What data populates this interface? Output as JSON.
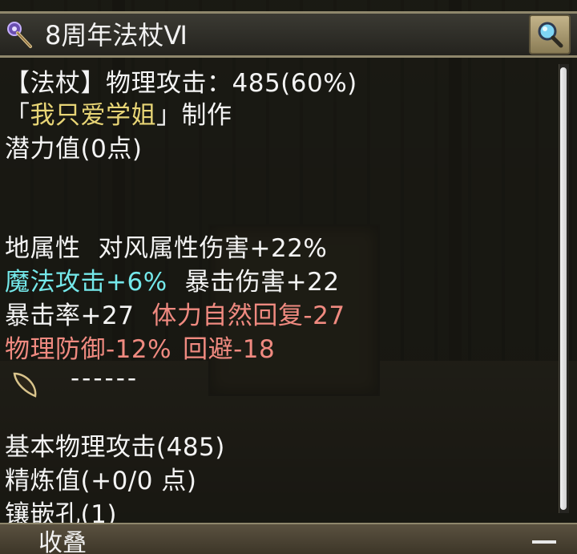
{
  "item": {
    "name": "8周年法杖Ⅵ",
    "icon": "wand-icon",
    "zoom_icon": "magnifier-icon"
  },
  "lines": {
    "type_attack": "【法杖】物理攻击：485(60%)",
    "maker_open": "「",
    "maker_name": "我只爱学姐",
    "maker_close": "」制作",
    "potential": "潜力值(0点)",
    "element_line": {
      "element": "地属性",
      "bonus": "对风属性伤害+22%"
    },
    "stats_1": {
      "magic_attack": "魔法攻击+6%",
      "crit_damage": "暴击伤害+22"
    },
    "stats_2": {
      "crit_rate": "暴击率+27",
      "hp_regen": "体力自然回复-27"
    },
    "stats_3": {
      "phys_def": "物理防御-12%",
      "evasion": "回避-18"
    },
    "gem_slot": {
      "icon": "gem-icon",
      "placeholder": "------"
    },
    "base_attack": "基本物理攻击(485)",
    "refine": "精炼值(+0/0 点)",
    "sockets": "镶嵌孔(1)"
  },
  "footer": {
    "collapse_label": "收叠",
    "minus_label": "—"
  },
  "colors": {
    "text": "#f4f4f4",
    "maker_name": "#e8d576",
    "positive_stat": "#74e8ea",
    "negative_stat": "#f08a80"
  }
}
